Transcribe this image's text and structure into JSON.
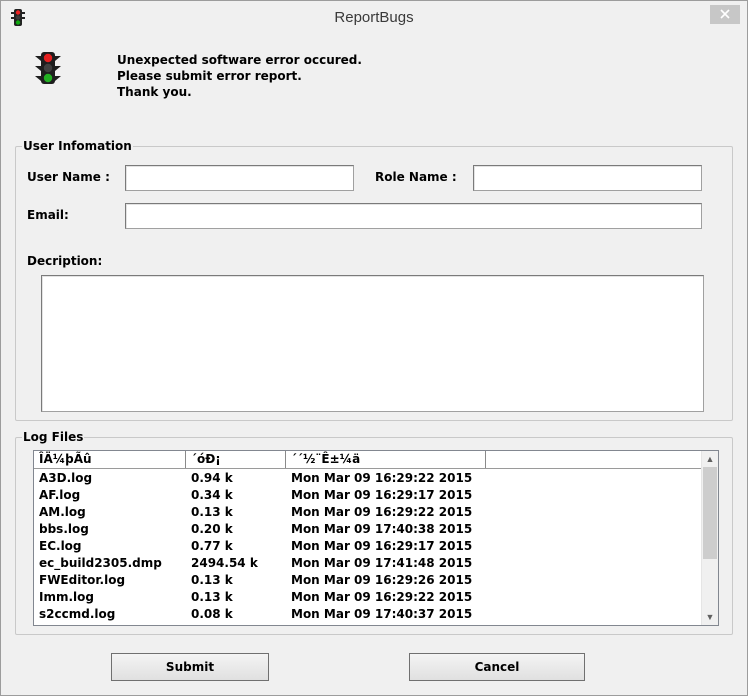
{
  "window": {
    "title": "ReportBugs",
    "icon": "traffic-light-icon",
    "close_icon": "close-icon"
  },
  "message": {
    "line1": "Unexpected software error occured.",
    "line2": "Please submit error report.",
    "line3": "Thank you."
  },
  "user_info": {
    "legend": "User Infomation",
    "user_name_label": "User Name :",
    "user_name_value": "",
    "role_name_label": "Role Name :",
    "role_name_value": "",
    "email_label": "Email:",
    "email_value": "",
    "description_label": "Decription:",
    "description_value": ""
  },
  "log_files": {
    "legend": "Log Files",
    "columns": [
      "ÎÄ¼þÃû",
      "´óÐ¡",
      "´´½¨Ê±¼ä"
    ],
    "rows": [
      {
        "name": "A3D.log",
        "size": "0.94 k",
        "created": "Mon Mar 09 16:29:22 2015"
      },
      {
        "name": "AF.log",
        "size": "0.34 k",
        "created": "Mon Mar 09 16:29:17 2015"
      },
      {
        "name": "AM.log",
        "size": "0.13 k",
        "created": "Mon Mar 09 16:29:22 2015"
      },
      {
        "name": "bbs.log",
        "size": "0.20 k",
        "created": "Mon Mar 09 17:40:38 2015"
      },
      {
        "name": "EC.log",
        "size": "0.77 k",
        "created": "Mon Mar 09 16:29:17 2015"
      },
      {
        "name": "ec_build2305.dmp",
        "size": "2494.54 k",
        "created": "Mon Mar 09 17:41:48 2015"
      },
      {
        "name": "FWEditor.log",
        "size": "0.13 k",
        "created": "Mon Mar 09 16:29:26 2015"
      },
      {
        "name": "Imm.log",
        "size": "0.13 k",
        "created": "Mon Mar 09 16:29:22 2015"
      },
      {
        "name": "s2ccmd.log",
        "size": "0.08 k",
        "created": "Mon Mar 09 17:40:37 2015"
      }
    ]
  },
  "buttons": {
    "submit": "Submit",
    "cancel": "Cancel"
  }
}
